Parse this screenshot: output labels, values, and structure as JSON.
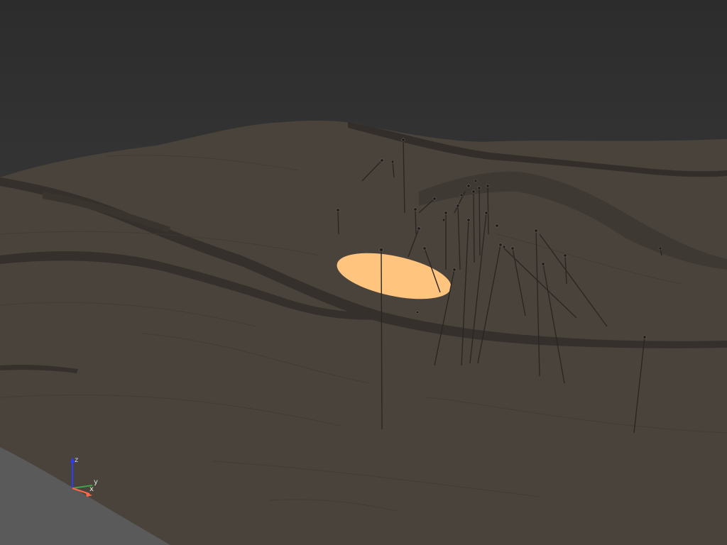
{
  "viewport": {
    "background_top": "#2c2c2c",
    "background_bottom": "#3a3a3a",
    "terrain_color": "#4a433c",
    "terrain_shadow": "#3a342e",
    "highlight_color": "#ffc57f",
    "drillhole_color": "#2a2623",
    "void_color": "#5a5a5a"
  },
  "axis_triad": {
    "z_label": "z",
    "y_label": "y",
    "x_label": "x",
    "z_color": "#2a3cff",
    "y_color": "#3fa34a",
    "x_color": "#ff6a4a"
  }
}
